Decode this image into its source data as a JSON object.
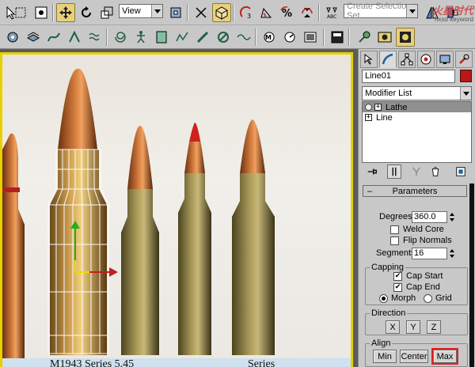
{
  "toolbar_top": {
    "view_dropdown": "View",
    "selection_set_placeholder": "Create Selection Set",
    "icons": [
      "select-icon",
      "region-select-icon",
      "select-by-name-icon",
      "move-icon",
      "rotate-icon",
      "scale-icon",
      "snap-icon",
      "angle-snap-icon",
      "percent-snap-icon",
      "spinner-snap-icon",
      "mirror-icon",
      "align-icon"
    ]
  },
  "toolbar_bottom": {
    "icons": [
      "curve-editor-icon",
      "schematic-icon",
      "material-editor-icon",
      "render-icon"
    ]
  },
  "viewport": {
    "watermark": "火星时代",
    "watermark_sub": "hxsd keyword",
    "caption_fragments": [
      "M1943 Series 5.45",
      "Series"
    ],
    "frame_color": "#e8d000"
  },
  "command_panel": {
    "object_name": "Line01",
    "object_color": "#b81818",
    "modifier_list_label": "Modifier List",
    "stack": [
      {
        "label": "Lathe",
        "selected": true
      },
      {
        "label": "Line",
        "selected": false
      }
    ],
    "rollout": {
      "title": "Parameters",
      "degrees_label": "Degrees:",
      "degrees_value": "360.0",
      "weld_core_label": "Weld Core",
      "weld_core_checked": false,
      "flip_normals_label": "Flip Normals",
      "flip_normals_checked": false,
      "segments_label": "Segments:",
      "segments_value": "16",
      "capping": {
        "title": "Capping",
        "cap_start_label": "Cap Start",
        "cap_start_checked": true,
        "cap_end_label": "Cap End",
        "cap_end_checked": true,
        "morph_label": "Morph",
        "grid_label": "Grid",
        "selected": "Morph"
      },
      "direction": {
        "title": "Direction",
        "x": "X",
        "y": "Y",
        "z": "Z"
      },
      "align": {
        "title": "Align",
        "min": "Min",
        "center": "Center",
        "max": "Max",
        "highlighted": "Max"
      }
    }
  }
}
